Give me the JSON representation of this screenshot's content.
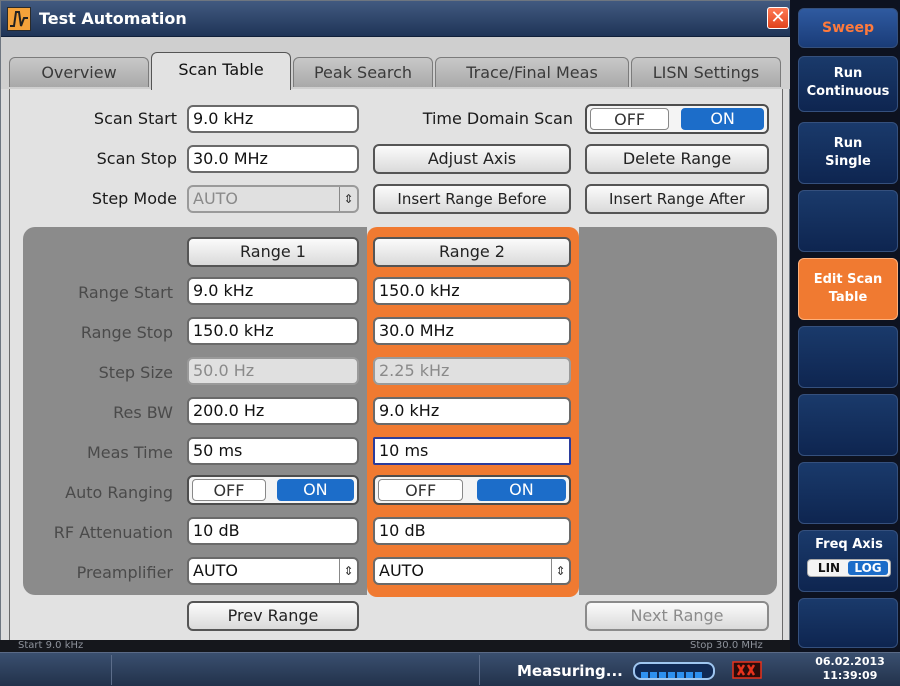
{
  "window": {
    "title": "Test Automation"
  },
  "tabs": [
    "Overview",
    "Scan Table",
    "Peak Search",
    "Trace/Final Meas",
    "LISN Settings"
  ],
  "active_tab": "Scan Table",
  "scan": {
    "start_label": "Scan Start",
    "start_value": "9.0 kHz",
    "stop_label": "Scan Stop",
    "stop_value": "30.0 MHz",
    "step_mode_label": "Step Mode",
    "step_mode_value": "AUTO",
    "time_domain_label": "Time Domain Scan",
    "time_domain_off": "OFF",
    "time_domain_on": "ON"
  },
  "buttons": {
    "adjust_axis": "Adjust Axis",
    "delete_range": "Delete Range",
    "insert_before": "Insert Range Before",
    "insert_after": "Insert Range After",
    "prev_range": "Prev Range",
    "next_range": "Next Range"
  },
  "row_labels": [
    "Range Start",
    "Range Stop",
    "Step Size",
    "Res BW",
    "Meas Time",
    "Auto Ranging",
    "RF Attenuation",
    "Preamplifier"
  ],
  "ranges": [
    {
      "header": "Range 1",
      "range_start": "9.0 kHz",
      "range_stop": "150.0 kHz",
      "step_size": "50.0 Hz",
      "res_bw": "200.0 Hz",
      "meas_time": "50 ms",
      "auto_off": "OFF",
      "auto_on": "ON",
      "rf_atten": "10 dB",
      "preamp": "AUTO"
    },
    {
      "header": "Range 2",
      "range_start": "150.0 kHz",
      "range_stop": "30.0 MHz",
      "step_size": "2.25 kHz",
      "res_bw": "9.0 kHz",
      "meas_time": "10 ms",
      "auto_off": "OFF",
      "auto_on": "ON",
      "rf_atten": "10 dB",
      "preamp": "AUTO"
    }
  ],
  "status": {
    "start_text": "Start 9.0 kHz",
    "stop_text": "Stop 30.0 MHz",
    "measuring": "Measuring...",
    "date": "06.02.2013",
    "time": "11:39:09"
  },
  "softkeys": {
    "sweep": "Sweep",
    "run_continuous": [
      "Run",
      "Continuous"
    ],
    "run_single": [
      "Run",
      "Single"
    ],
    "edit_scan_table": [
      "Edit Scan",
      "Table"
    ],
    "freq_axis": "Freq Axis",
    "lin": "LIN",
    "log": "LOG"
  },
  "colors": {
    "active_orange": "#f07a31",
    "toggle_blue": "#1c6dc9",
    "title_blue": "#2c4a75"
  }
}
